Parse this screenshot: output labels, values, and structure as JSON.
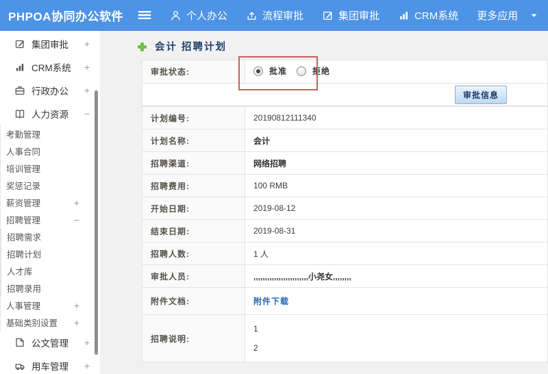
{
  "colors": {
    "topbar_blue": "#4d93e6",
    "annotation_red": "#c4615d",
    "link_blue": "#2a68b8",
    "navy_text": "#1e3d6e",
    "plus_green": "#74c83e",
    "plus_green_dark": "#4fa21d"
  },
  "topbar": {
    "logo": "PHPOA协同办公软件",
    "menu_icon": "menu-icon",
    "nav": [
      {
        "label": "个人办公",
        "icon": "user-icon"
      },
      {
        "label": "流程审批",
        "icon": "flow-icon"
      },
      {
        "label": "集团审批",
        "icon": "edit-icon"
      },
      {
        "label": "CRM系统",
        "icon": "chart-icon"
      },
      {
        "label": "更多应用",
        "icon": "",
        "caret": true
      }
    ]
  },
  "sidebar": {
    "items": [
      {
        "label": "集团审批",
        "icon": "edit-icon",
        "toggle": "+"
      },
      {
        "label": "CRM系统",
        "icon": "chart-icon",
        "toggle": "+"
      },
      {
        "label": "行政办公",
        "icon": "briefcase-icon",
        "toggle": "+"
      },
      {
        "label": "人力资源",
        "icon": "book-icon",
        "toggle": "−",
        "children": [
          {
            "label": "考勤管理"
          },
          {
            "label": "人事合同"
          },
          {
            "label": "培训管理"
          },
          {
            "label": "奖惩记录"
          },
          {
            "label": "薪资管理",
            "toggle": "+"
          },
          {
            "label": "招聘管理",
            "toggle": "−",
            "children": [
              {
                "label": "招聘需求"
              },
              {
                "label": "招聘计划"
              },
              {
                "label": "人才库"
              },
              {
                "label": "招聘录用"
              }
            ]
          },
          {
            "label": "人事管理",
            "toggle": "+"
          },
          {
            "label": "基础类别设置",
            "toggle": "+"
          }
        ]
      },
      {
        "label": "公文管理",
        "icon": "doc-icon",
        "toggle": "+"
      },
      {
        "label": "用车管理",
        "icon": "car-icon",
        "toggle": "+"
      }
    ]
  },
  "breadcrumb": {
    "icon": "plus-icon",
    "title": "会计 招聘计划"
  },
  "approval": {
    "status_label": "审批状态:",
    "options": [
      {
        "label": "批准",
        "selected": true
      },
      {
        "label": "拒绝",
        "selected": false
      }
    ],
    "button_label": "审批信息"
  },
  "details": {
    "rows": [
      {
        "label": "计划编号:",
        "value": "20190812111340"
      },
      {
        "label": "计划名称:",
        "value": "会计",
        "bold": true
      },
      {
        "label": "招聘渠道:",
        "value": "网络招聘",
        "bold": true
      },
      {
        "label": "招聘费用:",
        "value": "100 RMB"
      },
      {
        "label": "开始日期:",
        "value": "2019-08-12"
      },
      {
        "label": "结束日期:",
        "value": "2019-08-31"
      },
      {
        "label": "招聘人数:",
        "value": "1 人"
      },
      {
        "label": "审批人员:",
        "value": ",,,,,,,,,,,,,,,,,,,,,,,,小尧女,,,,,,,,",
        "bold": true
      },
      {
        "label": "附件文档:",
        "value": "附件下载",
        "link": true
      },
      {
        "label": "招聘说明:",
        "lines": [
          "1",
          "2"
        ]
      }
    ]
  }
}
